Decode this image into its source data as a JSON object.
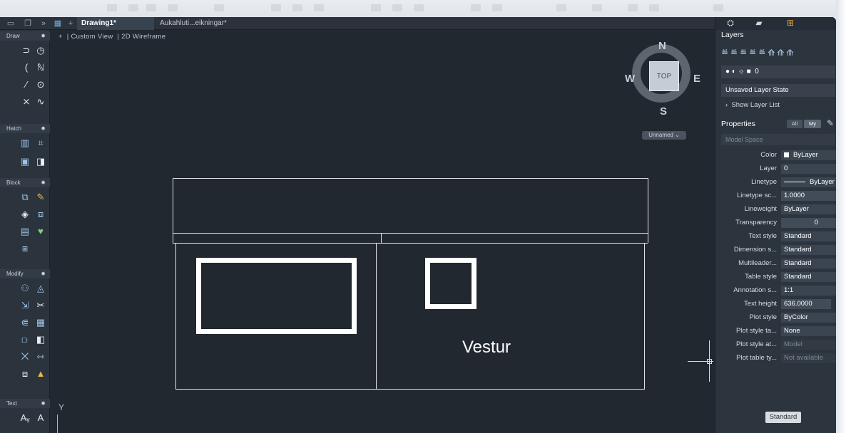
{
  "tabs": {
    "active": "Drawing1*",
    "inactive": "Aukahluti...eikningar*"
  },
  "viewport": {
    "plus": "+",
    "view_label": "Custom View",
    "visual_style": "2D Wireframe",
    "ucs_axis": "Y",
    "text_on_drawing": "Vestur"
  },
  "viewcube": {
    "north": "N",
    "south": "S",
    "east": "E",
    "west": "W",
    "face": "TOP",
    "named_view": "Unnamed"
  },
  "palette": {
    "sections": [
      "Draw",
      "Hatch",
      "Block",
      "Modify",
      "Text"
    ]
  },
  "layers": {
    "title": "Layers",
    "current_layer": "0",
    "layer_state": "Unsaved Layer State",
    "show_list": "Show Layer List"
  },
  "properties": {
    "title": "Properties",
    "filter_all": "All",
    "filter_my": "My",
    "space": "Model Space",
    "rows": [
      {
        "label": "Color",
        "value": "ByLayer"
      },
      {
        "label": "Layer",
        "value": "0"
      },
      {
        "label": "Linetype",
        "value": "ByLayer"
      },
      {
        "label": "Linetype sc...",
        "value": "1.0000"
      },
      {
        "label": "Lineweight",
        "value": "ByLayer"
      },
      {
        "label": "Transparency",
        "value": "0"
      },
      {
        "label": "Text style",
        "value": "Standard"
      },
      {
        "label": "Dimension s...",
        "value": "Standard"
      },
      {
        "label": "Multileader...",
        "value": "Standard"
      },
      {
        "label": "Table style",
        "value": "Standard"
      },
      {
        "label": "Annotation s...",
        "value": "1:1"
      },
      {
        "label": "Text height",
        "value": "636.0000"
      },
      {
        "label": "Plot style",
        "value": "ByColor"
      },
      {
        "label": "Plot style ta...",
        "value": "None"
      },
      {
        "label": "Plot style at...",
        "value": "Model"
      },
      {
        "label": "Plot table ty...",
        "value": "Not available"
      }
    ],
    "bottom_button": "Standard"
  }
}
